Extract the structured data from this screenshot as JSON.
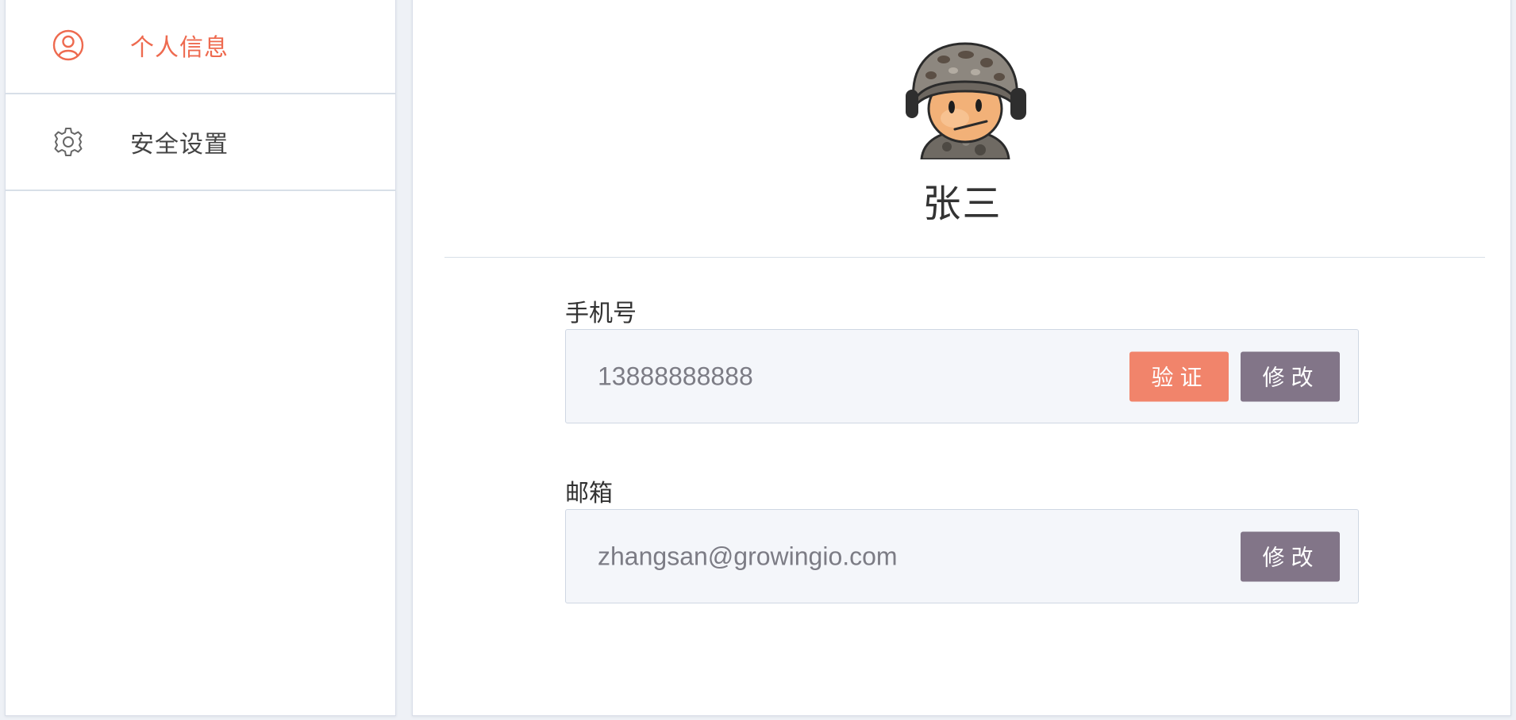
{
  "sidebar": {
    "items": [
      {
        "label": "个人信息",
        "icon": "user-icon",
        "active": true
      },
      {
        "label": "安全设置",
        "icon": "gear-icon",
        "active": false
      }
    ]
  },
  "profile": {
    "name": "张三",
    "avatar": "soldier-avatar"
  },
  "fields": {
    "phone": {
      "label": "手机号",
      "value": "13888888888",
      "verify_label": "验证",
      "edit_label": "修改"
    },
    "email": {
      "label": "邮箱",
      "value": "zhangsan@growingio.com",
      "edit_label": "修改"
    }
  },
  "colors": {
    "accent": "#ee6a4f",
    "verify_button": "#f1846b",
    "edit_button": "#827588",
    "field_background": "#f4f6fa"
  }
}
